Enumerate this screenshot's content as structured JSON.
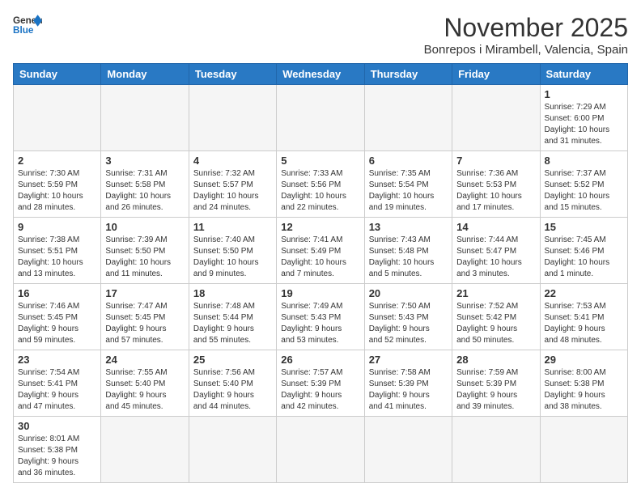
{
  "header": {
    "logo_general": "General",
    "logo_blue": "Blue",
    "month_title": "November 2025",
    "location": "Bonrepos i Mirambell, Valencia, Spain"
  },
  "weekdays": [
    "Sunday",
    "Monday",
    "Tuesday",
    "Wednesday",
    "Thursday",
    "Friday",
    "Saturday"
  ],
  "days": [
    {
      "num": "",
      "info": "",
      "empty": true
    },
    {
      "num": "",
      "info": "",
      "empty": true
    },
    {
      "num": "",
      "info": "",
      "empty": true
    },
    {
      "num": "",
      "info": "",
      "empty": true
    },
    {
      "num": "",
      "info": "",
      "empty": true
    },
    {
      "num": "",
      "info": "",
      "empty": true
    },
    {
      "num": "1",
      "info": "Sunrise: 7:29 AM\nSunset: 6:00 PM\nDaylight: 10 hours\nand 31 minutes.",
      "empty": false
    },
    {
      "num": "2",
      "info": "Sunrise: 7:30 AM\nSunset: 5:59 PM\nDaylight: 10 hours\nand 28 minutes.",
      "empty": false
    },
    {
      "num": "3",
      "info": "Sunrise: 7:31 AM\nSunset: 5:58 PM\nDaylight: 10 hours\nand 26 minutes.",
      "empty": false
    },
    {
      "num": "4",
      "info": "Sunrise: 7:32 AM\nSunset: 5:57 PM\nDaylight: 10 hours\nand 24 minutes.",
      "empty": false
    },
    {
      "num": "5",
      "info": "Sunrise: 7:33 AM\nSunset: 5:56 PM\nDaylight: 10 hours\nand 22 minutes.",
      "empty": false
    },
    {
      "num": "6",
      "info": "Sunrise: 7:35 AM\nSunset: 5:54 PM\nDaylight: 10 hours\nand 19 minutes.",
      "empty": false
    },
    {
      "num": "7",
      "info": "Sunrise: 7:36 AM\nSunset: 5:53 PM\nDaylight: 10 hours\nand 17 minutes.",
      "empty": false
    },
    {
      "num": "8",
      "info": "Sunrise: 7:37 AM\nSunset: 5:52 PM\nDaylight: 10 hours\nand 15 minutes.",
      "empty": false
    },
    {
      "num": "9",
      "info": "Sunrise: 7:38 AM\nSunset: 5:51 PM\nDaylight: 10 hours\nand 13 minutes.",
      "empty": false
    },
    {
      "num": "10",
      "info": "Sunrise: 7:39 AM\nSunset: 5:50 PM\nDaylight: 10 hours\nand 11 minutes.",
      "empty": false
    },
    {
      "num": "11",
      "info": "Sunrise: 7:40 AM\nSunset: 5:50 PM\nDaylight: 10 hours\nand 9 minutes.",
      "empty": false
    },
    {
      "num": "12",
      "info": "Sunrise: 7:41 AM\nSunset: 5:49 PM\nDaylight: 10 hours\nand 7 minutes.",
      "empty": false
    },
    {
      "num": "13",
      "info": "Sunrise: 7:43 AM\nSunset: 5:48 PM\nDaylight: 10 hours\nand 5 minutes.",
      "empty": false
    },
    {
      "num": "14",
      "info": "Sunrise: 7:44 AM\nSunset: 5:47 PM\nDaylight: 10 hours\nand 3 minutes.",
      "empty": false
    },
    {
      "num": "15",
      "info": "Sunrise: 7:45 AM\nSunset: 5:46 PM\nDaylight: 10 hours\nand 1 minute.",
      "empty": false
    },
    {
      "num": "16",
      "info": "Sunrise: 7:46 AM\nSunset: 5:45 PM\nDaylight: 9 hours\nand 59 minutes.",
      "empty": false
    },
    {
      "num": "17",
      "info": "Sunrise: 7:47 AM\nSunset: 5:45 PM\nDaylight: 9 hours\nand 57 minutes.",
      "empty": false
    },
    {
      "num": "18",
      "info": "Sunrise: 7:48 AM\nSunset: 5:44 PM\nDaylight: 9 hours\nand 55 minutes.",
      "empty": false
    },
    {
      "num": "19",
      "info": "Sunrise: 7:49 AM\nSunset: 5:43 PM\nDaylight: 9 hours\nand 53 minutes.",
      "empty": false
    },
    {
      "num": "20",
      "info": "Sunrise: 7:50 AM\nSunset: 5:43 PM\nDaylight: 9 hours\nand 52 minutes.",
      "empty": false
    },
    {
      "num": "21",
      "info": "Sunrise: 7:52 AM\nSunset: 5:42 PM\nDaylight: 9 hours\nand 50 minutes.",
      "empty": false
    },
    {
      "num": "22",
      "info": "Sunrise: 7:53 AM\nSunset: 5:41 PM\nDaylight: 9 hours\nand 48 minutes.",
      "empty": false
    },
    {
      "num": "23",
      "info": "Sunrise: 7:54 AM\nSunset: 5:41 PM\nDaylight: 9 hours\nand 47 minutes.",
      "empty": false
    },
    {
      "num": "24",
      "info": "Sunrise: 7:55 AM\nSunset: 5:40 PM\nDaylight: 9 hours\nand 45 minutes.",
      "empty": false
    },
    {
      "num": "25",
      "info": "Sunrise: 7:56 AM\nSunset: 5:40 PM\nDaylight: 9 hours\nand 44 minutes.",
      "empty": false
    },
    {
      "num": "26",
      "info": "Sunrise: 7:57 AM\nSunset: 5:39 PM\nDaylight: 9 hours\nand 42 minutes.",
      "empty": false
    },
    {
      "num": "27",
      "info": "Sunrise: 7:58 AM\nSunset: 5:39 PM\nDaylight: 9 hours\nand 41 minutes.",
      "empty": false
    },
    {
      "num": "28",
      "info": "Sunrise: 7:59 AM\nSunset: 5:39 PM\nDaylight: 9 hours\nand 39 minutes.",
      "empty": false
    },
    {
      "num": "29",
      "info": "Sunrise: 8:00 AM\nSunset: 5:38 PM\nDaylight: 9 hours\nand 38 minutes.",
      "empty": false
    },
    {
      "num": "30",
      "info": "Sunrise: 8:01 AM\nSunset: 5:38 PM\nDaylight: 9 hours\nand 36 minutes.",
      "empty": false
    },
    {
      "num": "",
      "info": "",
      "empty": true
    },
    {
      "num": "",
      "info": "",
      "empty": true
    },
    {
      "num": "",
      "info": "",
      "empty": true
    },
    {
      "num": "",
      "info": "",
      "empty": true
    },
    {
      "num": "",
      "info": "",
      "empty": true
    },
    {
      "num": "",
      "info": "",
      "empty": true
    }
  ]
}
